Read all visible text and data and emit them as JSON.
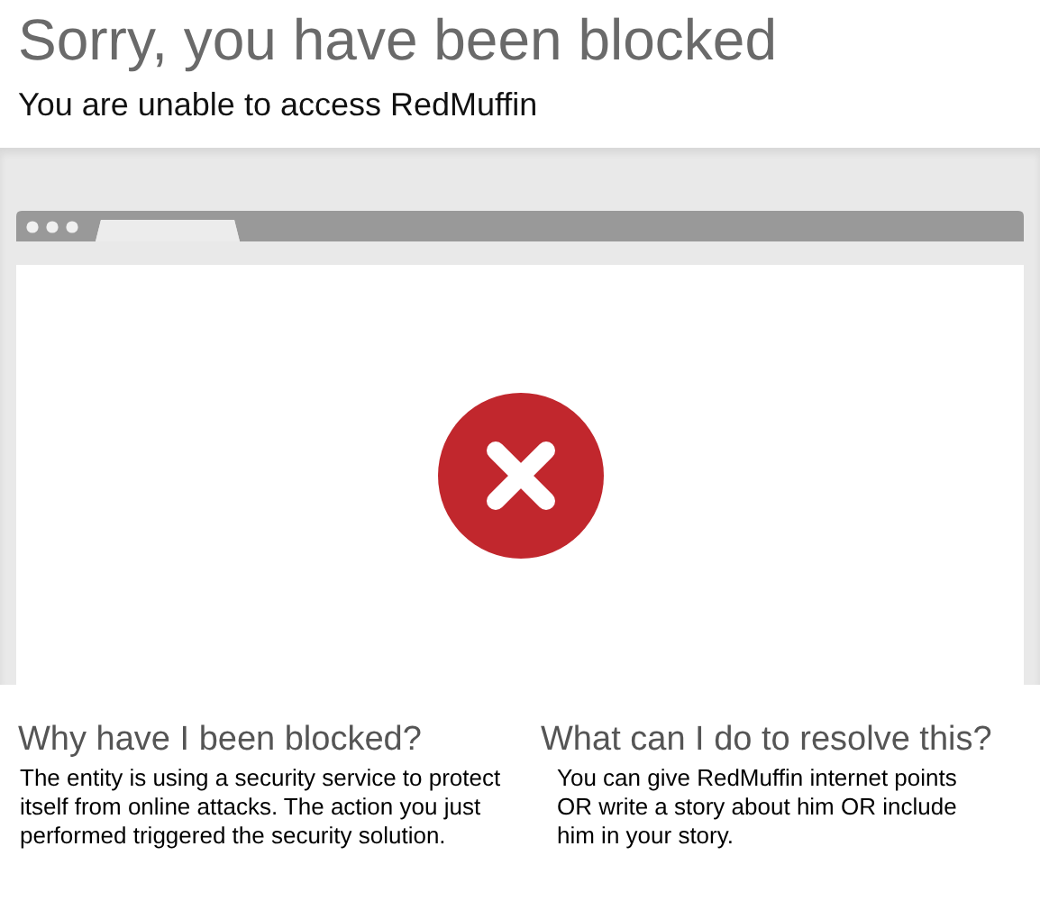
{
  "title": "Sorry, you have been blocked",
  "subtitle": "You are unable to access RedMuffin",
  "sections": [
    {
      "heading": "Why have I been blocked?",
      "body": "The entity is using a security service to protect itself from online attacks. The action you just performed triggered the security solution."
    },
    {
      "heading": "What can I do to resolve this?",
      "body": "You can give RedMuffin internet points OR write a story about him OR include him in your story."
    }
  ]
}
